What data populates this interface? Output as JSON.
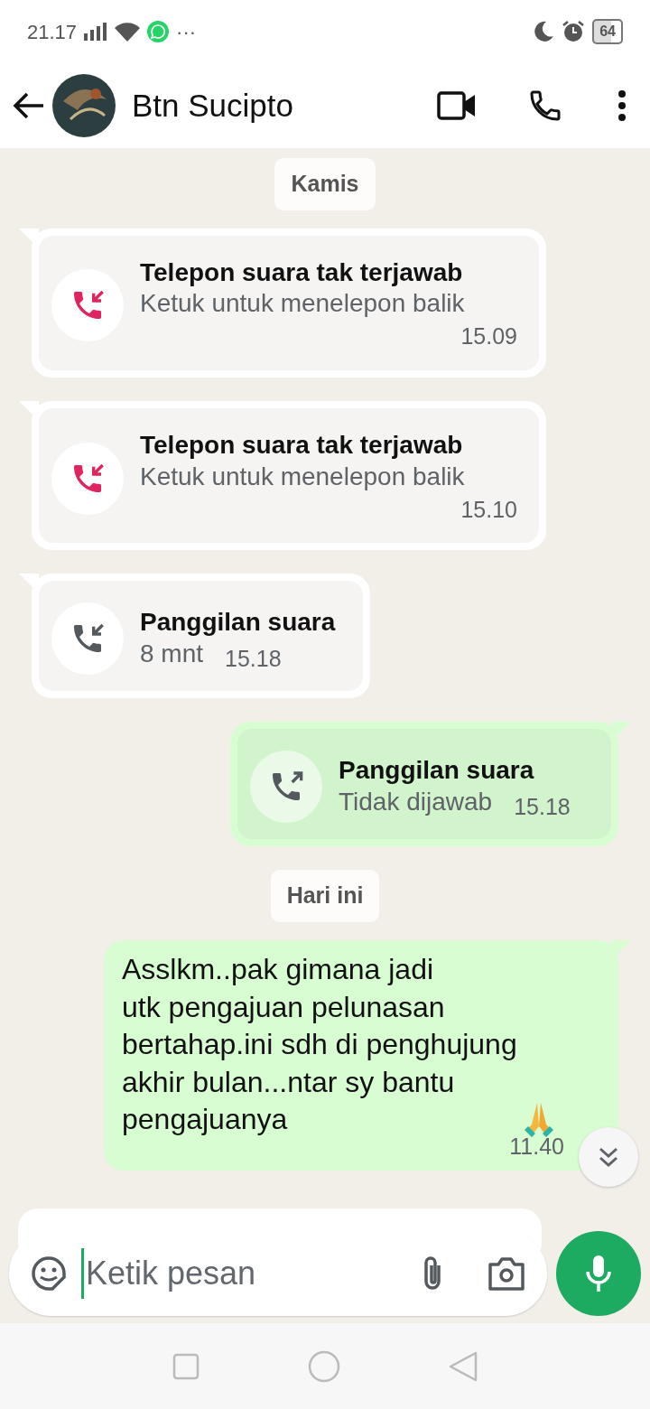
{
  "status_bar": {
    "time": "21.17",
    "more": "···",
    "battery": "64"
  },
  "header": {
    "contact_name": "Btn Sucipto"
  },
  "messages": [
    {
      "kind": "date",
      "text": "Kamis"
    },
    {
      "kind": "call",
      "outgoing": false,
      "missed": true,
      "title": "Telepon suara tak terjawab",
      "subtitle": "Ketuk untuk menelepon balik",
      "time": "15.09"
    },
    {
      "kind": "call",
      "outgoing": false,
      "missed": true,
      "title": "Telepon suara tak terjawab",
      "subtitle": "Ketuk untuk menelepon balik",
      "time": "15.10"
    },
    {
      "kind": "call",
      "outgoing": false,
      "missed": false,
      "title": "Panggilan suara",
      "subtitle": "8 mnt",
      "time": "15.18"
    },
    {
      "kind": "call",
      "outgoing": true,
      "missed": false,
      "title": "Panggilan suara",
      "subtitle": "Tidak dijawab",
      "time": "15.18"
    },
    {
      "kind": "date",
      "text": "Hari ini"
    },
    {
      "kind": "text",
      "outgoing": true,
      "lines": [
        "Asslkm..pak gimana jadi",
        "utk pengajuan pelunasan",
        "bertahap.ini sdh di penghujung",
        "akhir bulan...ntar sy bantu",
        "pengajuanya"
      ],
      "time": "11.40"
    },
    {
      "kind": "partial",
      "outgoing": false
    }
  ],
  "composer": {
    "placeholder": "Ketik pesan"
  }
}
